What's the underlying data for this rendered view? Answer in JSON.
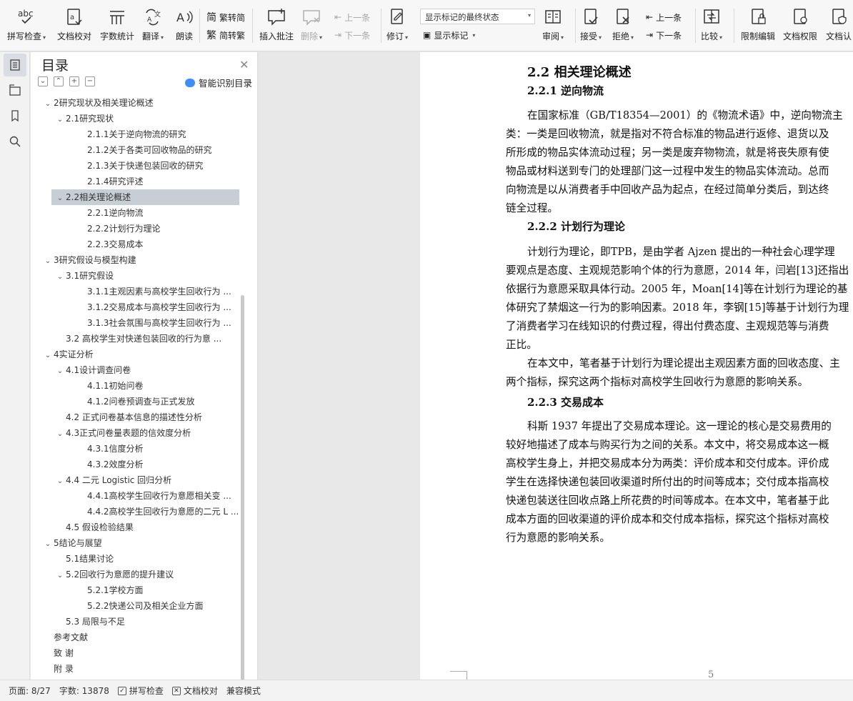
{
  "ribbon": {
    "spell_check": "拼写检查",
    "doc_check": "文档校对",
    "word_count": "字数统计",
    "translate": "翻译",
    "read_aloud": "朗读",
    "to_traditional": "繁转简",
    "to_simplified": "简转繁",
    "insert_comment": "插入批注",
    "delete": "删除",
    "prev_comment": "上一条",
    "next_comment": "下一条",
    "revise": "修订",
    "markup_state": "显示标记的最终状态",
    "show_markup": "显示标记",
    "review": "审阅",
    "accept": "接受",
    "reject": "拒绝",
    "prev_change": "上一条",
    "next_change": "下一条",
    "compare": "比较",
    "restrict_edit": "限制编辑",
    "doc_permission": "文档权限",
    "doc_cert": "文档认"
  },
  "nav": {
    "title": "目录",
    "smart_toc": "智能识别目录",
    "items": [
      {
        "label": "2研究现状及相关理论概述",
        "level": 1,
        "chev": true
      },
      {
        "label": "2.1研究现状",
        "level": 2,
        "chev": true
      },
      {
        "label": "2.1.1关于逆向物流的研究",
        "level": 3
      },
      {
        "label": "2.1.2关于各类可回收物品的研究",
        "level": 3
      },
      {
        "label": "2.1.3关于快递包装回收的研究",
        "level": 3
      },
      {
        "label": "2.1.4研究评述",
        "level": 3
      },
      {
        "label": "2.2相关理论概述",
        "level": 2,
        "chev": true,
        "selected": true
      },
      {
        "label": "2.2.1逆向物流",
        "level": 3
      },
      {
        "label": "2.2.2计划行为理论",
        "level": 3
      },
      {
        "label": "2.2.3交易成本",
        "level": 3
      },
      {
        "label": "3研究假设与模型构建",
        "level": 1,
        "chev": true
      },
      {
        "label": "3.1研究假设",
        "level": 2,
        "chev": true
      },
      {
        "label": "3.1.1主观因素与高校学生回收行为 ...",
        "level": 3
      },
      {
        "label": "3.1.2交易成本与高校学生回收行为 ...",
        "level": 3
      },
      {
        "label": "3.1.3社会氛围与高校学生回收行为 ...",
        "level": 3
      },
      {
        "label": "3.2 高校学生对快递包装回收的行为意 ...",
        "level": 2
      },
      {
        "label": "4实证分析",
        "level": 1,
        "chev": true
      },
      {
        "label": "4.1设计调查问卷",
        "level": 2,
        "chev": true
      },
      {
        "label": "4.1.1初始问卷",
        "level": 3
      },
      {
        "label": "4.1.2问卷预调查与正式发放",
        "level": 3
      },
      {
        "label": "4.2 正式问卷基本信息的描述性分析",
        "level": 2
      },
      {
        "label": "4.3正式问卷量表题的信效度分析",
        "level": 2,
        "chev": true
      },
      {
        "label": "4.3.1信度分析",
        "level": 3
      },
      {
        "label": "4.3.2效度分析",
        "level": 3
      },
      {
        "label": "4.4 二元 Logistic 回归分析",
        "level": 2,
        "chev": true
      },
      {
        "label": "4.4.1高校学生回收行为意愿相关变 ...",
        "level": 3
      },
      {
        "label": "4.4.2高校学生回收行为意愿的二元 L ...",
        "level": 3
      },
      {
        "label": "4.5 假设检验结果",
        "level": 2
      },
      {
        "label": "5结论与展望",
        "level": 1,
        "chev": true
      },
      {
        "label": "5.1结果讨论",
        "level": 2
      },
      {
        "label": "5.2回收行为意愿的提升建议",
        "level": 2,
        "chev": true
      },
      {
        "label": "5.2.1学校方面",
        "level": 3
      },
      {
        "label": "5.2.2快递公司及相关企业方面",
        "level": 3
      },
      {
        "label": "5.3 局限与不足",
        "level": 2
      },
      {
        "label": "参考文献",
        "level": 1
      },
      {
        "label": "致  谢",
        "level": 1
      },
      {
        "label": "附  录",
        "level": 1
      }
    ]
  },
  "doc": {
    "h_2_2": "2.2  相关理论概述",
    "h_2_2_1": "2.2.1  逆向物流",
    "p1": [
      "在国家标准（GB/T18354—2001）的《物流术语》中，逆向物流主",
      "类：一类是回收物流，就是指对不符合标准的物品进行返修、退货以及",
      "所形成的物品实体流动过程；另一类是废弃物物流，就是将丧失原有使",
      "物品或材料送到专门的处理部门这一过程中发生的物品实体流动。总而",
      "向物流是以从消费者手中回收产品为起点，在经过简单分类后，到达终",
      "链全过程。"
    ],
    "h_2_2_2": "2.2.2  计划行为理论",
    "p2": [
      "计划行为理论，即TPB，是由学者 Ajzen 提出的一种社会心理学理",
      "要观点是态度、主观规范影响个体的行为意愿，2014 年，闫岩[13]还指出",
      "依据行为意愿采取具体行动。2005  年，Moan[14]等在计划行为理论的基",
      "体研究了禁烟这一行为的影响因素。2018 年，李钢[15]等基于计划行为理",
      "了消费者学习在线知识的付费过程，得出付费态度、主观规范等与消费",
      "正比。"
    ],
    "p3": [
      "在本文中，笔者基于计划行为理论提出主观因素方面的回收态度、主",
      "两个指标，探究这两个指标对高校学生回收行为意愿的影响关系。"
    ],
    "h_2_2_3": "2.2.3  交易成本",
    "p4": [
      "科斯  1937 年提出了交易成本理论。这一理论的核心是交易费用的",
      "较好地描述了成本与购买行为之间的关系。本文中，将交易成本这一概",
      "高校学生身上，并把交易成本分为两类：评价成本和交付成本。评价成",
      "学生在选择快递包装回收渠道时所付出的时间等成本；交付成本指高校",
      "快递包装送往回收点路上所花费的时间等成本。在本文中，笔者基于此",
      "成本方面的回收渠道的评价成本和交付成本指标，探究这个指标对高校",
      "行为意愿的影响关系。"
    ],
    "page_number": "5"
  },
  "status": {
    "page": "页面: 8/27",
    "words": "字数: 13878",
    "spell": "拼写检查",
    "proof": "文档校对",
    "compat": "兼容模式"
  }
}
